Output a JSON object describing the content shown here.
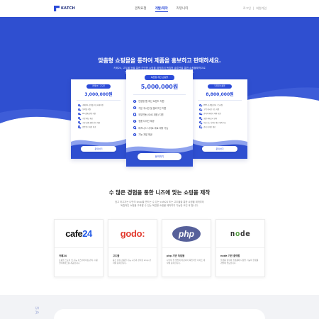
{
  "header": {
    "logo": "KATCH",
    "nav": [
      "견적요청",
      "개발/제작",
      "커뮤니티"
    ],
    "auth": [
      "로그인",
      "회원가입"
    ]
  },
  "hero": {
    "title": "맞춤형 쇼핑몰을 통하여 제품을 홍보하고 판매하세요.",
    "desc_line1": "카페24, 고도몰 등을 통한 간단한 쇼핑몰 제작부터 독립형 솔루션을 통한 쇼핑몰제작으로",
    "desc_line2": "원으로 하는 나만의 쇼핑몰을 제작하여 나만의 shop을 운영하세요."
  },
  "pricing": [
    {
      "badge": "카페24 / 고도몰",
      "price": "3,000,000원",
      "features": [
        "카페24, 쇼핑몰 커스터마이징",
        "모바일 지원",
        "PG 결제 관련 지원",
        "기본 메뉴 제공",
        "기본 상품 관련 관리 제공",
        "반응형 디자인 제공"
      ],
      "button": "문의하기"
    },
    {
      "badge": "독립형 개인 쇼핑몰",
      "price": "5,000,000원",
      "features": [
        "반응형 웹 최신 트렌드 지원",
        "기본 게시판 및 플러그인 지원",
        "외부연동 (SNS 계정) 지원",
        "정품 디자인 제공",
        "퍼즈니스 사이트 바로 제작 가능",
        "기능 개발 제공"
      ],
      "button": "문의하기"
    },
    {
      "badge": "독립형 쇼핑몰",
      "price": "8,800,000원",
      "features": [
        "PHP, 쇼핑몰 관리 / 스타일",
        "고객 게시판 기능 지원",
        "관리자 페이지 제작 지원",
        "회원 카테고리 관리",
        "퍼즈니스 사이트 바로 제작 가능",
        "관리 디자인 제공"
      ],
      "button": "문의하기"
    }
  ],
  "section": {
    "title": "수 많은 경험을 통한 니즈에 맞는 쇼핑몰 제작",
    "desc_line1": "정고 하고자는 나만의 shop을 만드는 수 있는 cafe24 또는 고도몰을 통한 쇼핑몰 제작부터",
    "desc_line2": "독립적인 쇼핑몰 구축할 수 있는 독립형 쇼핑몰 제작까지 가능한 요인 후 합니다."
  },
  "techs": [
    {
      "logo": "cafe24",
      "name": "카페24",
      "desc": "쇼핑몰 스토어 및 기능 커스터마이징 관리, 쉬운 인터페이스를 제공합니다."
    },
    {
      "logo": "godo",
      "name": "고도몰",
      "desc": "중소 상점 쇼핑몰 기능 구현과 관리된 shop 관리에 용이합니다."
    },
    {
      "logo": "php",
      "name": "php 기반 독립몰",
      "desc": "나만의 몰 방법의 확장되어 독립적인 사이트 제작에 용이합니다."
    },
    {
      "logo": "node",
      "name": "node 기반 플랫폼",
      "desc": "플랫폼 형식의 플랫폼에 다양한 기능의 플랫폼 개발에 필요합니다."
    }
  ],
  "bottom": {
    "vertical_text": "SA"
  },
  "colors": {
    "primary": "#2f4fd0",
    "accent": "#2b4bd8",
    "php": "#56609a",
    "godo": "#e23a2e",
    "node_green": "#4f9b3b"
  }
}
